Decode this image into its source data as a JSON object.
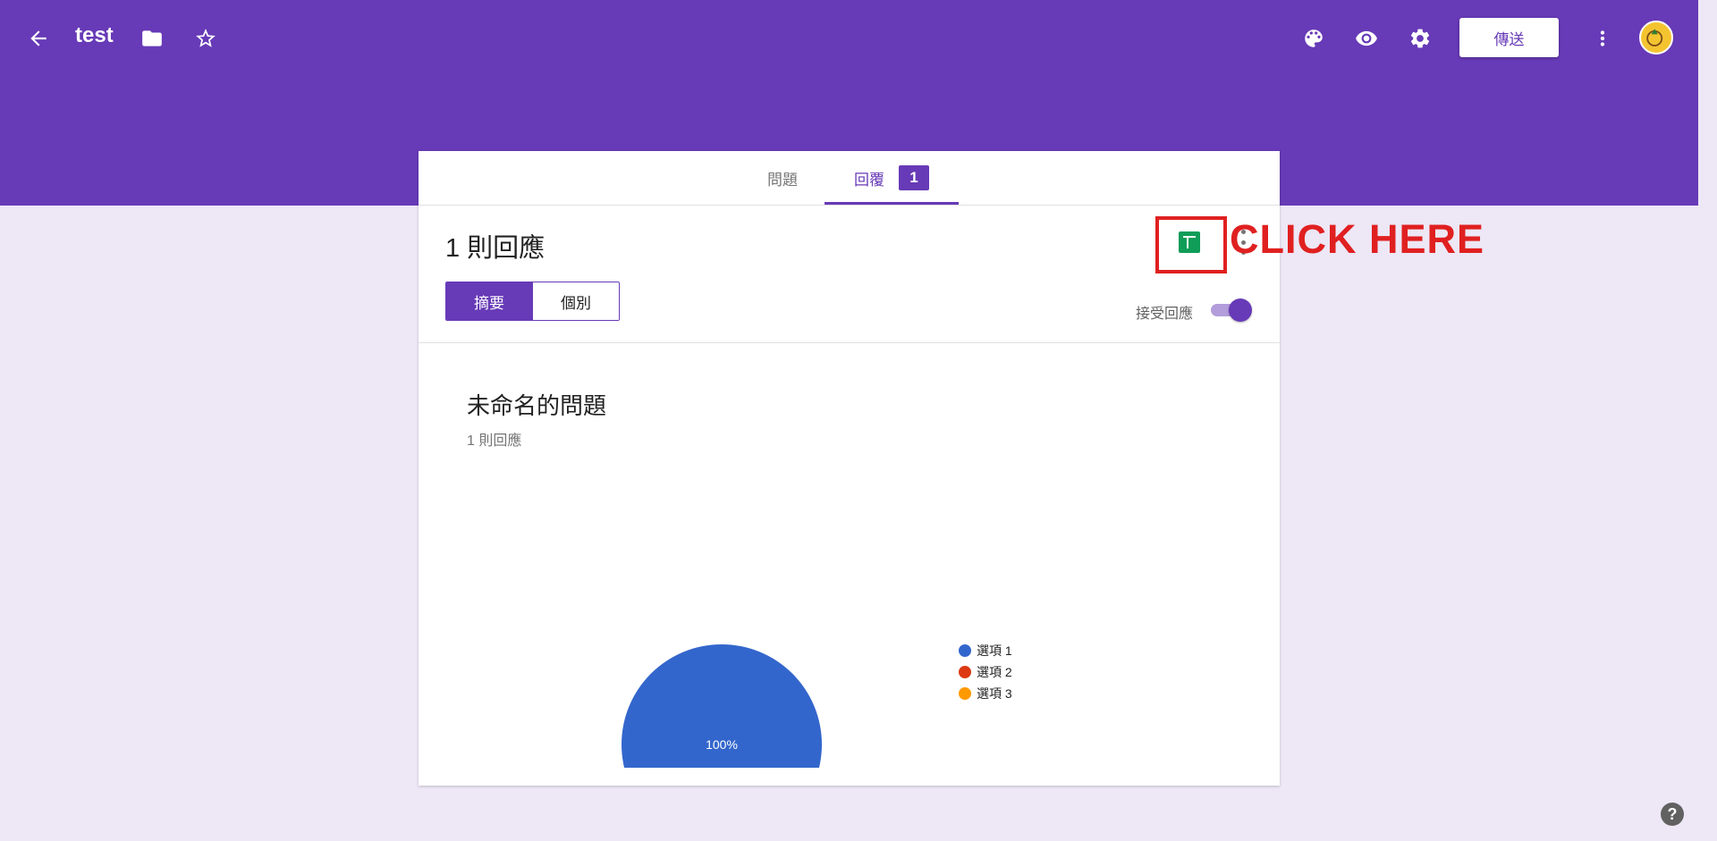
{
  "header": {
    "title": "test",
    "send_label": "傳送",
    "accent_color": "#673ab7",
    "icons": [
      "back-arrow-icon",
      "folder-icon",
      "star-icon",
      "palette-icon",
      "eye-icon",
      "gear-icon",
      "more-vert-icon"
    ]
  },
  "tabs": [
    {
      "label": "問題"
    },
    {
      "label": "回覆",
      "badge": "1",
      "active": true
    }
  ],
  "responses": {
    "count_title": "1 則回應",
    "segments": [
      "摘要",
      "個別"
    ],
    "accepting_label": "接受回應",
    "accepting": true
  },
  "annotation": {
    "text": "CLICK HERE",
    "color": "#e02020"
  },
  "question": {
    "title": "未命名的問題",
    "subtitle": "1 則回應"
  },
  "chart_data": {
    "type": "pie",
    "categories": [
      "選項 1",
      "選項 2",
      "選項 3"
    ],
    "values": [
      100,
      0,
      0
    ],
    "colors": [
      "#3366cc",
      "#dc3912",
      "#ff9900"
    ],
    "slice_labels": [
      "100%"
    ],
    "legend_position": "right"
  },
  "help": {
    "label": "?"
  }
}
